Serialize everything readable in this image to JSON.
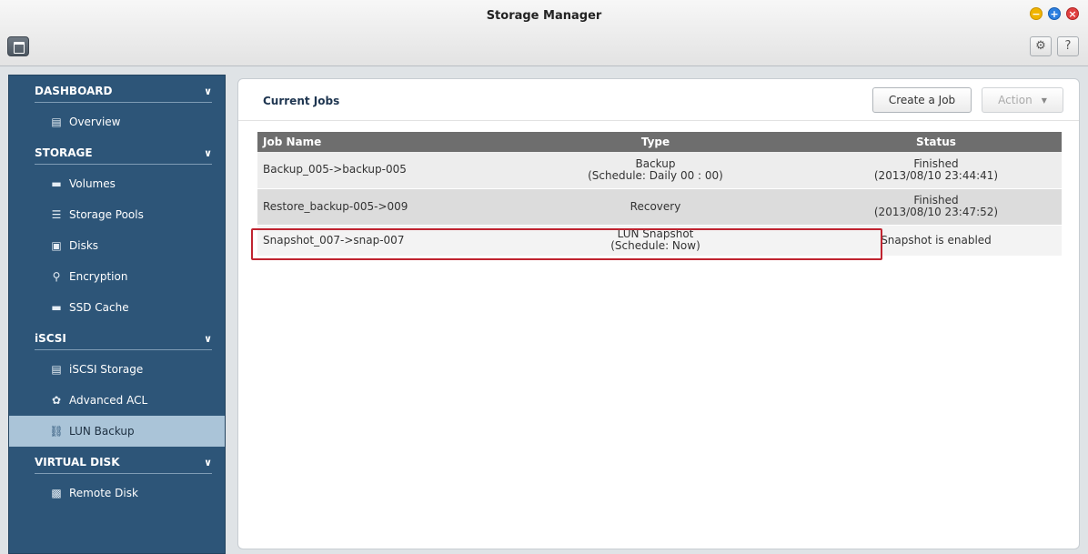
{
  "window": {
    "title": "Storage Manager"
  },
  "toolbar": {
    "settings_icon": "gear-icon",
    "help_label": "?"
  },
  "sidebar": {
    "sections": [
      {
        "label": "DASHBOARD",
        "items": [
          {
            "label": "Overview",
            "icon": "overview-icon"
          }
        ]
      },
      {
        "label": "STORAGE",
        "items": [
          {
            "label": "Volumes",
            "icon": "volume-icon"
          },
          {
            "label": "Storage Pools",
            "icon": "storage-pool-icon"
          },
          {
            "label": "Disks",
            "icon": "disk-icon"
          },
          {
            "label": "Encryption",
            "icon": "key-icon"
          },
          {
            "label": "SSD Cache",
            "icon": "ssd-icon"
          }
        ]
      },
      {
        "label": "iSCSI",
        "items": [
          {
            "label": "iSCSI Storage",
            "icon": "iscsi-storage-icon"
          },
          {
            "label": "Advanced ACL",
            "icon": "acl-gear-icon"
          },
          {
            "label": "LUN Backup",
            "icon": "lun-backup-icon",
            "active": true
          }
        ]
      },
      {
        "label": "VIRTUAL DISK",
        "items": [
          {
            "label": "Remote Disk",
            "icon": "remote-disk-icon"
          }
        ]
      }
    ]
  },
  "main": {
    "title": "Current Jobs",
    "create_button": "Create a Job",
    "action_button": "Action",
    "columns": [
      "Job Name",
      "Type",
      "Status"
    ],
    "rows": [
      {
        "name": "Backup_005->backup-005",
        "type": "Backup",
        "type_sub": "(Schedule: Daily 00 : 00)",
        "status": "Finished",
        "status_sub": "(2013/08/10 23:44:41)"
      },
      {
        "name": "Restore_backup-005->009",
        "type": "Recovery",
        "type_sub": "",
        "status": "Finished",
        "status_sub": "(2013/08/10 23:47:52)"
      },
      {
        "name": "Snapshot_007->snap-007",
        "type": "LUN Snapshot",
        "type_sub": "(Schedule: Now)",
        "status": "Snapshot is enabled",
        "status_sub": ""
      }
    ]
  },
  "colors": {
    "sidebar_bg": "#2d5578",
    "active_item": "#aac4d8",
    "highlight_border": "#c02430",
    "table_header": "#6e6e6e"
  }
}
